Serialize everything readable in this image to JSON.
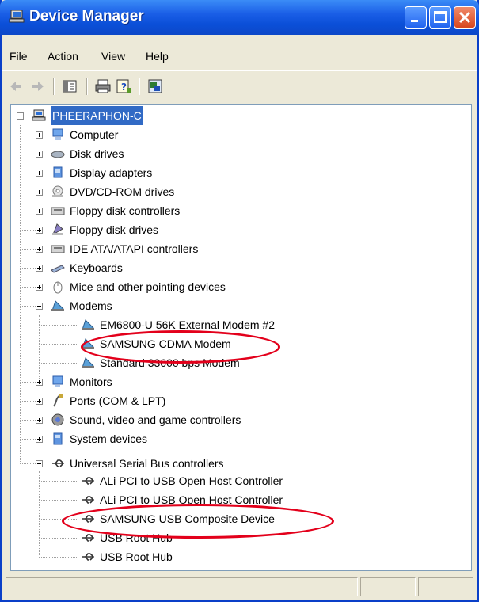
{
  "window": {
    "title": "Device Manager"
  },
  "menu": [
    "File",
    "Action",
    "View",
    "Help"
  ],
  "tree": {
    "root": "PHEERAPHON-C",
    "categories": [
      {
        "label": "Computer",
        "icon": "computer-icon"
      },
      {
        "label": "Disk drives",
        "icon": "disk-drive-icon"
      },
      {
        "label": "Display adapters",
        "icon": "display-adapter-icon"
      },
      {
        "label": "DVD/CD-ROM drives",
        "icon": "cdrom-icon"
      },
      {
        "label": "Floppy disk controllers",
        "icon": "floppy-controller-icon"
      },
      {
        "label": "Floppy disk drives",
        "icon": "floppy-drive-icon"
      },
      {
        "label": "IDE ATA/ATAPI controllers",
        "icon": "ide-controller-icon"
      },
      {
        "label": "Keyboards",
        "icon": "keyboard-icon"
      },
      {
        "label": "Mice and other pointing devices",
        "icon": "mouse-icon"
      },
      {
        "label": "Modems",
        "icon": "modem-icon"
      },
      {
        "label": "Monitors",
        "icon": "monitor-icon"
      },
      {
        "label": "Ports (COM & LPT)",
        "icon": "port-icon"
      },
      {
        "label": "Sound, video and game controllers",
        "icon": "sound-icon"
      },
      {
        "label": "System devices",
        "icon": "system-device-icon"
      },
      {
        "label": "Universal Serial Bus controllers",
        "icon": "usb-icon"
      }
    ],
    "modems": [
      "EM6800-U 56K External Modem #2",
      "SAMSUNG CDMA Modem",
      "Standard 33600 bps Modem"
    ],
    "usb": [
      "ALi PCI to USB Open Host Controller",
      "ALi PCI to USB Open Host Controller",
      "SAMSUNG USB Composite Device",
      "USB Root Hub",
      "USB Root Hub"
    ]
  },
  "colors": {
    "selection": "#316ac5",
    "highlight_circle": "#e3001b",
    "titlebar": "#0b4fd8"
  }
}
